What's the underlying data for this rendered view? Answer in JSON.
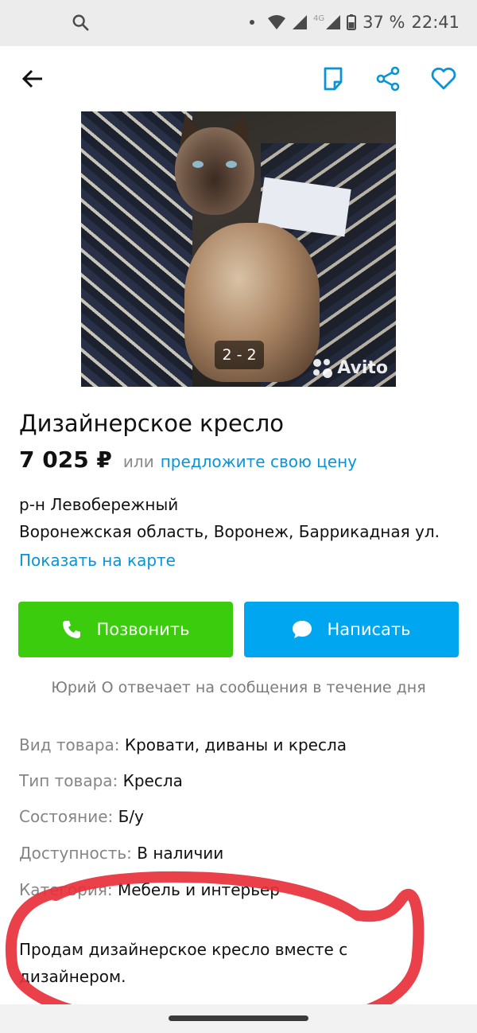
{
  "status_bar": {
    "network": "4G",
    "battery": "37 %",
    "time": "22:41"
  },
  "icons": {
    "back": "arrow-left-icon",
    "note": "note-icon",
    "share": "share-icon",
    "favorite": "heart-icon"
  },
  "colors": {
    "accent_blue": "#0a94d6",
    "call_green": "#3ccc0e",
    "message_blue": "#00a6f0",
    "annotation_red": "#e8303a"
  },
  "gallery": {
    "counter": "2 - 2",
    "watermark": "Avito"
  },
  "listing": {
    "title": "Дизайнерское кресло",
    "price": "7 025 ₽",
    "price_or": "или",
    "offer_link": "предложите свою цену",
    "district": "р-н Левобережный",
    "address": "Воронежская область, Воронеж, Баррикадная ул.",
    "map_link": "Показать на карте"
  },
  "actions": {
    "call_label": "Позвонить",
    "message_label": "Написать"
  },
  "seller_note": "Юрий О отвечает на сообщения в течение дня",
  "params": [
    {
      "key": "Вид товара:",
      "value": "Кровати, диваны и кресла"
    },
    {
      "key": "Тип товара:",
      "value": "Кресла"
    },
    {
      "key": "Состояние:",
      "value": "Б/у"
    },
    {
      "key": "Доступность:",
      "value": "В наличии"
    },
    {
      "key": "Категория:",
      "value": "Мебель и интерьер"
    }
  ],
  "description": "Продам дизайнерское кресло вместе с дизайнером."
}
